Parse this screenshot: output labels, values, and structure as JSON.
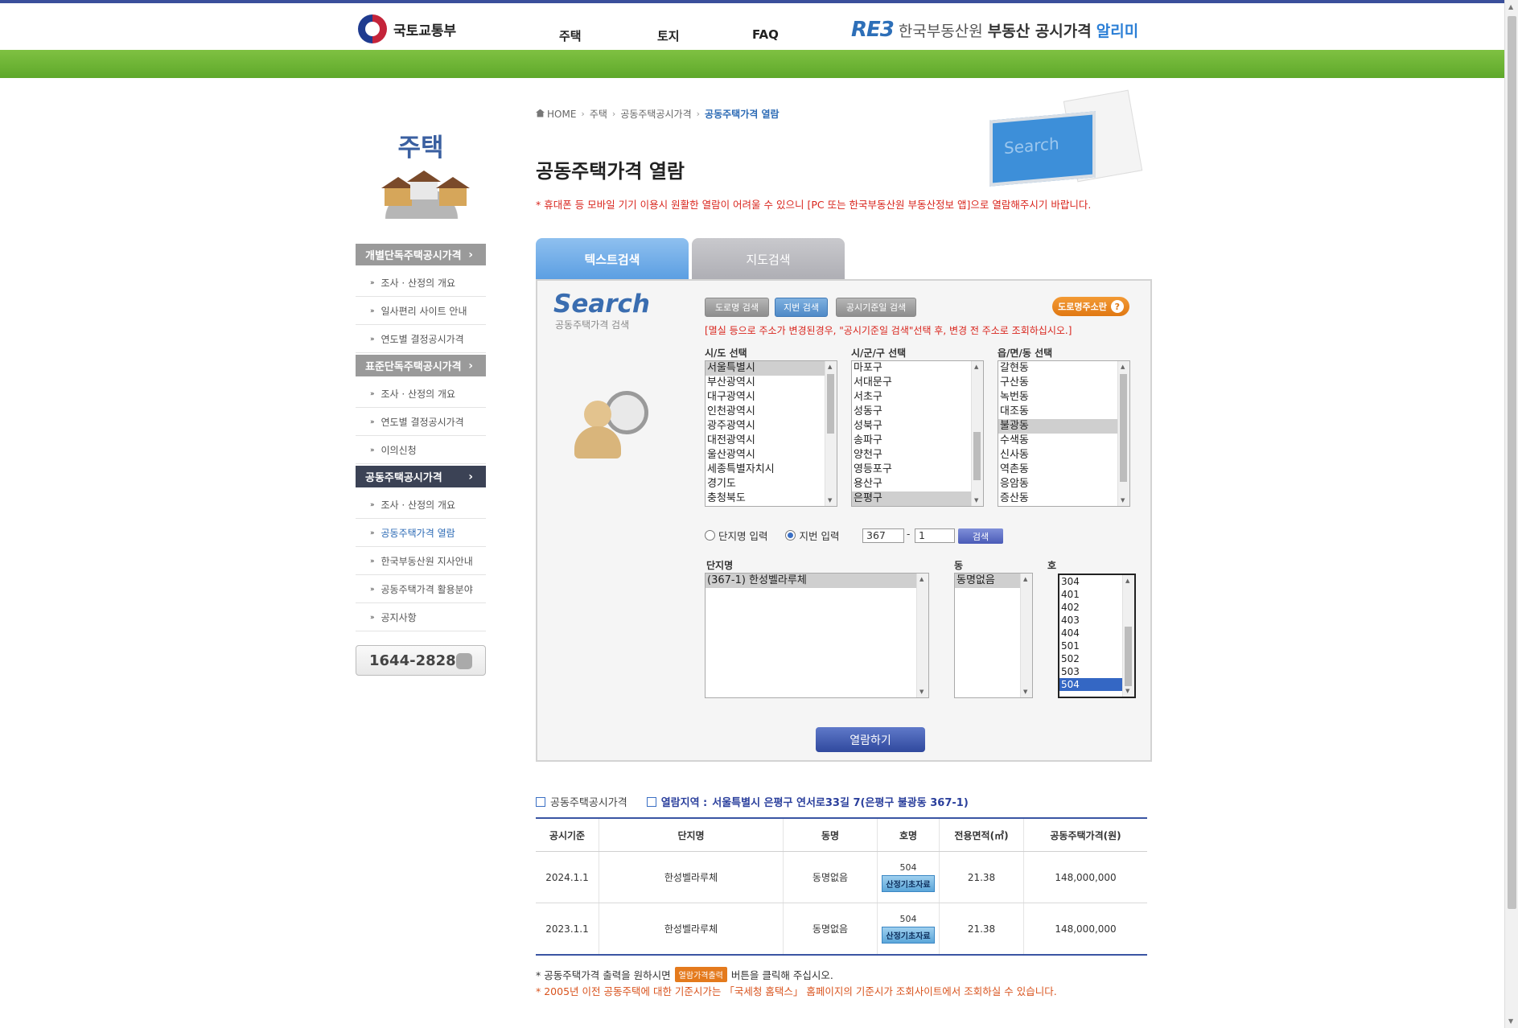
{
  "header": {
    "ministry": "국토교통부",
    "nav": [
      "주택",
      "토지",
      "FAQ"
    ],
    "reb_mark": "RE3",
    "reb_name": "한국부동산원",
    "reb_service": "부동산 공시가격",
    "reb_service_accent": "알리미"
  },
  "sidebar": {
    "title": "주택",
    "groups": [
      {
        "label": "개별단독주택공시가격",
        "items": [
          "조사 · 산정의 개요",
          "일사편리 사이트 안내",
          "연도별 결정공시가격"
        ]
      },
      {
        "label": "표준단독주택공시가격",
        "items": [
          "조사 · 산정의 개요",
          "연도별 결정공시가격",
          "이의신청"
        ]
      },
      {
        "label": "공동주택공시가격",
        "items": [
          "조사 · 산정의 개요",
          "공동주택가격 열람",
          "한국부동산원 지사안내",
          "공동주택가격 활용분야",
          "공지사항"
        ]
      }
    ],
    "phone": "1644-2828"
  },
  "breadcrumb": [
    "HOME",
    "주택",
    "공동주택공시가격",
    "공동주택가격 열람"
  ],
  "page_title": "공동주택가격 열람",
  "mobile_notice": "* 휴대폰 등 모바일 기기 이용시 원활한 열람이 어려울 수 있으니 [PC 또는 한국부동산원 부동산정보 앱]으로 열람해주시기 바랍니다.",
  "illustration_text": "Search",
  "tabs": [
    "텍스트검색",
    "지도검색"
  ],
  "search": {
    "logo_big": "Search",
    "logo_small": "공동주택가격 검색",
    "buttons": [
      "도로명 검색",
      "지번 검색",
      "공시기준일 검색"
    ],
    "road_address_btn": "도로명주소란",
    "road_address_help": "?",
    "warning": "[멸실 등으로 주소가 변경된경우, \"공시기준일 검색\"선택 후, 변경 전 주소로 조회하십시오.]",
    "sido_label": "시/도 선택",
    "sido_options": [
      "서울특별시",
      "부산광역시",
      "대구광역시",
      "인천광역시",
      "광주광역시",
      "대전광역시",
      "울산광역시",
      "세종특별자치시",
      "경기도",
      "충청북도"
    ],
    "sido_selected": 0,
    "sigungu_label": "시/군/구 선택",
    "sigungu_options": [
      "마포구",
      "서대문구",
      "서초구",
      "성동구",
      "성북구",
      "송파구",
      "양천구",
      "영등포구",
      "용산구",
      "은평구"
    ],
    "sigungu_selected": 9,
    "dong_label": "읍/면/동 선택",
    "dong_options": [
      "갈현동",
      "구산동",
      "녹번동",
      "대조동",
      "불광동",
      "수색동",
      "신사동",
      "역촌동",
      "응암동",
      "증산동"
    ],
    "dong_selected": 4,
    "radio_complex": "단지명 입력",
    "radio_jibun": "지번 입력",
    "jibun_main": "367",
    "jibun_dash": "-",
    "jibun_sub": "1",
    "search_btn": "검색",
    "complex_label": "단지명",
    "complex_options": [
      "(367-1) 한성벨라루체"
    ],
    "building_label": "동",
    "building_options": [
      "동명없음"
    ],
    "unit_label": "호",
    "unit_options": [
      "304",
      "401",
      "402",
      "403",
      "404",
      "501",
      "502",
      "503",
      "504"
    ],
    "unit_selected": 8,
    "view_btn": "열람하기"
  },
  "results": {
    "section_label": "공동주택공시가격",
    "region_label": "열람지역 :",
    "region_value": "서울특별시 은평구 연서로33길 7(은평구 불광동 367-1)",
    "columns": [
      "공시기준",
      "단지명",
      "동명",
      "호명",
      "전용면적(㎡)",
      "공동주택가격(원)"
    ],
    "rows": [
      {
        "basis": "2024.1.1",
        "complex": "한성벨라루체",
        "building": "동명없음",
        "unit": "504",
        "unit_btn": "산정기초자료",
        "area": "21.38",
        "price": "148,000,000"
      },
      {
        "basis": "2023.1.1",
        "complex": "한성벨라루체",
        "building": "동명없음",
        "unit": "504",
        "unit_btn": "산정기초자료",
        "area": "21.38",
        "price": "148,000,000"
      }
    ]
  },
  "footer_note1_pre": "* 공동주택가격 출력을 원하시면",
  "footer_print_btn": "열람가격출력",
  "footer_note1_post": "버튼을 클릭해 주십시오.",
  "footer_note2": "* 2005년 이전 공동주택에 대한 기준시가는 「국세청 홈택스」 홈페이지의 기준시가 조회사이트에서 조회하실 수 있습니다.",
  "colors": {
    "brand_blue": "#3a4f9b",
    "green_bar": "#6cb535",
    "notice_red": "#d9251d",
    "accent_orange": "#e07812"
  }
}
